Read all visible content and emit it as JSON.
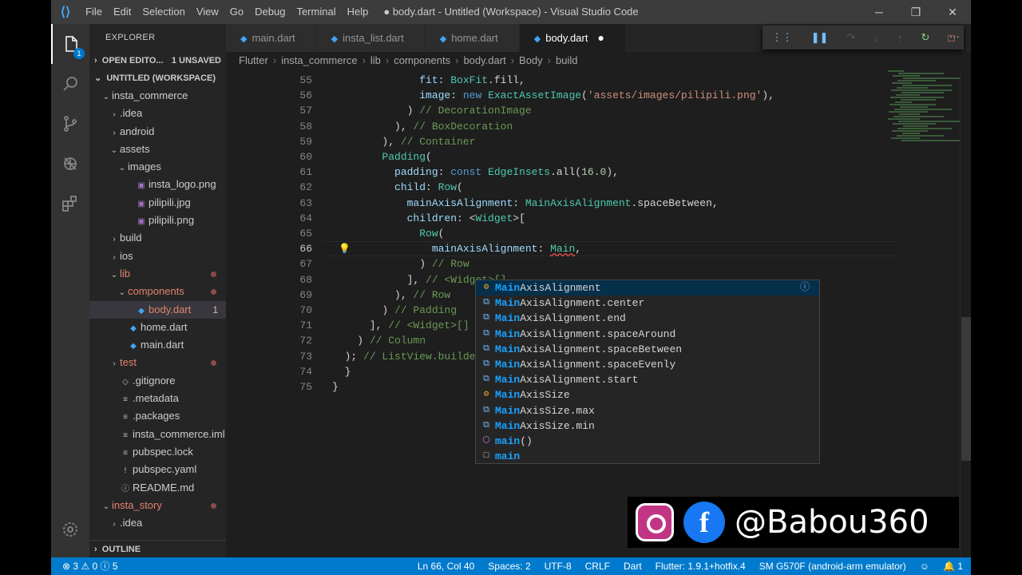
{
  "titlebar": {
    "menu": [
      "File",
      "Edit",
      "Selection",
      "View",
      "Go",
      "Debug",
      "Terminal",
      "Help"
    ],
    "title": "● body.dart - Untitled (Workspace) - Visual Studio Code",
    "controls": [
      "minimize-icon",
      "restore-icon",
      "close-icon"
    ]
  },
  "activity": {
    "items": [
      "files-icon",
      "search-icon",
      "source-control-icon",
      "debug-icon",
      "extensions-icon"
    ],
    "badge": "1",
    "gear": "gear-icon"
  },
  "sidebar": {
    "header": "EXPLORER",
    "open_editors": "OPEN EDITO...",
    "unsaved": "1 UNSAVED",
    "workspace": "UNTITLED (WORKSPACE)",
    "tree": [
      {
        "label": "insta_commerce",
        "depth": 1,
        "tw": "v",
        "icon": "",
        "color": "#cccccc"
      },
      {
        "label": ".idea",
        "depth": 2,
        "tw": ">",
        "icon": "",
        "color": "#cccccc"
      },
      {
        "label": "android",
        "depth": 2,
        "tw": ">",
        "icon": "",
        "color": "#cccccc"
      },
      {
        "label": "assets",
        "depth": 2,
        "tw": "v",
        "icon": "",
        "color": "#cccccc"
      },
      {
        "label": "images",
        "depth": 3,
        "tw": "v",
        "icon": "",
        "color": "#cccccc"
      },
      {
        "label": "insta_logo.png",
        "depth": 4,
        "tw": "",
        "icon": "▣",
        "color": "#cccccc"
      },
      {
        "label": "pilipili.jpg",
        "depth": 4,
        "tw": "",
        "icon": "▣",
        "color": "#cccccc"
      },
      {
        "label": "pilipili.png",
        "depth": 4,
        "tw": "",
        "icon": "▣",
        "color": "#cccccc"
      },
      {
        "label": "build",
        "depth": 2,
        "tw": ">",
        "icon": "",
        "color": "#cccccc"
      },
      {
        "label": "ios",
        "depth": 2,
        "tw": ">",
        "icon": "",
        "color": "#cccccc"
      },
      {
        "label": "lib",
        "depth": 2,
        "tw": "v",
        "icon": "",
        "color": "#e2826d",
        "dot": true
      },
      {
        "label": "components",
        "depth": 3,
        "tw": "v",
        "icon": "",
        "color": "#e2826d",
        "dot": true
      },
      {
        "label": "body.dart",
        "depth": 4,
        "tw": "",
        "icon": "◆",
        "color": "#e2826d",
        "num": "1",
        "selected": true
      },
      {
        "label": "home.dart",
        "depth": 3,
        "tw": "",
        "icon": "◆",
        "color": "#cccccc"
      },
      {
        "label": "main.dart",
        "depth": 3,
        "tw": "",
        "icon": "◆",
        "color": "#cccccc"
      },
      {
        "label": "test",
        "depth": 2,
        "tw": ">",
        "icon": "",
        "color": "#e2826d",
        "dot": true
      },
      {
        "label": ".gitignore",
        "depth": 2,
        "tw": "",
        "icon": "◇",
        "color": "#cccccc"
      },
      {
        "label": ".metadata",
        "depth": 2,
        "tw": "",
        "icon": "≡",
        "color": "#cccccc"
      },
      {
        "label": ".packages",
        "depth": 2,
        "tw": "",
        "icon": "≡",
        "color": "#cccccc"
      },
      {
        "label": "insta_commerce.iml",
        "depth": 2,
        "tw": "",
        "icon": "≡",
        "color": "#cccccc"
      },
      {
        "label": "pubspec.lock",
        "depth": 2,
        "tw": "",
        "icon": "≡",
        "color": "#cccccc"
      },
      {
        "label": "pubspec.yaml",
        "depth": 2,
        "tw": "",
        "icon": "!",
        "color": "#cccccc"
      },
      {
        "label": "README.md",
        "depth": 2,
        "tw": "",
        "icon": "ⓘ",
        "color": "#cccccc"
      },
      {
        "label": "insta_story",
        "depth": 1,
        "tw": "v",
        "icon": "",
        "color": "#e2826d",
        "dot": true
      },
      {
        "label": ".idea",
        "depth": 2,
        "tw": ">",
        "icon": "",
        "color": "#cccccc"
      }
    ],
    "outline": "OUTLINE"
  },
  "tabs": [
    {
      "label": "main.dart",
      "active": false,
      "modified": false
    },
    {
      "label": "insta_list.dart",
      "active": false,
      "modified": false
    },
    {
      "label": "home.dart",
      "active": false,
      "modified": false
    },
    {
      "label": "body.dart",
      "active": true,
      "modified": true
    }
  ],
  "debug_toolbar": [
    "drag-icon",
    "pause-icon",
    "step-over-icon",
    "step-into-icon",
    "step-out-icon",
    "restart-icon",
    "stop-icon"
  ],
  "more_actions": "more-actions-icon",
  "breadcrumb": [
    "Flutter",
    "insta_commerce",
    "lib",
    "components",
    "body.dart",
    "Body",
    "build"
  ],
  "code": {
    "lines": [
      {
        "n": "55",
        "html": "              <span class=\"p\">fit</span>: <span class=\"t\">BoxFit</span>.fill,"
      },
      {
        "n": "56",
        "html": "              <span class=\"p\">image</span>: <span class=\"k\">new</span> <span class=\"t\">ExactAssetImage</span>(<span class=\"s\">'assets/images/pilipili.png'</span>),"
      },
      {
        "n": "57",
        "html": "            ) <span class=\"c\">// DecorationImage</span>"
      },
      {
        "n": "58",
        "html": "          ), <span class=\"c\">// BoxDecoration</span>"
      },
      {
        "n": "59",
        "html": "        ), <span class=\"c\">// Container</span>"
      },
      {
        "n": "60",
        "html": "        <span class=\"t\">Padding</span>("
      },
      {
        "n": "61",
        "html": "          <span class=\"p\">padding</span>: <span class=\"k\">const</span> <span class=\"t\">EdgeInsets</span>.all(<span class=\"n\">16.0</span>),"
      },
      {
        "n": "62",
        "html": "          <span class=\"p\">child</span>: <span class=\"t\">Row</span>("
      },
      {
        "n": "63",
        "html": "            <span class=\"p\">mainAxisAlignment</span>: <span class=\"t\">MainAxisAlignment</span>.spaceBetween,"
      },
      {
        "n": "64",
        "html": "            <span class=\"p\">children</span>: &lt;<span class=\"t\">Widget</span>&gt;["
      },
      {
        "n": "65",
        "html": "              <span class=\"t\">Row</span>("
      },
      {
        "n": "66",
        "html": "                <span class=\"p\">mainAxisAlignment</span>: <span class=\"t\" style=\"text-decoration:underline wavy #f14c4c\">Main</span>,"
      },
      {
        "n": "67",
        "html": "              ) <span class=\"c\">// Row</span>"
      },
      {
        "n": "68",
        "html": "            ], <span class=\"c\">// &lt;Widget&gt;[]</span>"
      },
      {
        "n": "69",
        "html": "          ), <span class=\"c\">// Row</span>"
      },
      {
        "n": "70",
        "html": "        ) <span class=\"c\">// Padding</span>"
      },
      {
        "n": "71",
        "html": "      ], <span class=\"c\">// &lt;Widget&gt;[]</span>"
      },
      {
        "n": "72",
        "html": "    ) <span class=\"c\">// Column</span>"
      },
      {
        "n": "73",
        "html": "  ); <span class=\"c\">// ListView.builder</span>"
      },
      {
        "n": "74",
        "html": "  }"
      },
      {
        "n": "75",
        "html": "}"
      }
    ],
    "current_line": "66"
  },
  "suggestions": [
    {
      "match": "Main",
      "rest": "AxisAlignment",
      "icon": "class-icon",
      "selected": true
    },
    {
      "match": "Main",
      "rest": "AxisAlignment.center",
      "icon": "enum-member-icon"
    },
    {
      "match": "Main",
      "rest": "AxisAlignment.end",
      "icon": "enum-member-icon"
    },
    {
      "match": "Main",
      "rest": "AxisAlignment.spaceAround",
      "icon": "enum-member-icon"
    },
    {
      "match": "Main",
      "rest": "AxisAlignment.spaceBetween",
      "icon": "enum-member-icon"
    },
    {
      "match": "Main",
      "rest": "AxisAlignment.spaceEvenly",
      "icon": "enum-member-icon"
    },
    {
      "match": "Main",
      "rest": "AxisAlignment.start",
      "icon": "enum-member-icon"
    },
    {
      "match": "Main",
      "rest": "AxisSize",
      "icon": "class-icon"
    },
    {
      "match": "Main",
      "rest": "AxisSize.max",
      "icon": "enum-member-icon"
    },
    {
      "match": "Main",
      "rest": "AxisSize.min",
      "icon": "enum-member-icon"
    },
    {
      "match": "main",
      "rest": "()",
      "icon": "method-icon"
    },
    {
      "match": "main",
      "rest": "",
      "icon": "keyword-icon"
    }
  ],
  "statusbar": {
    "left": "⊗ 3  ⚠ 0  ⓘ 5",
    "cursor": "Ln 66, Col 40",
    "spaces": "Spaces: 2",
    "encoding": "UTF-8",
    "eol": "CRLF",
    "lang": "Dart",
    "flutter": "Flutter: 1.9.1+hotfix.4",
    "device": "SM G570F (android-arm emulator)",
    "feedback": "☺",
    "bell": "🔔 1"
  },
  "overlay": {
    "handle": "@Babou360",
    "fb": "f"
  }
}
